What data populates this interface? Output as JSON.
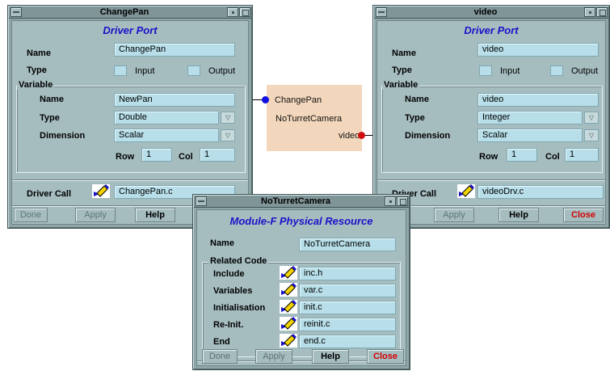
{
  "changepan_window": {
    "title": "ChangePan",
    "header": "Driver Port",
    "name_label": "Name",
    "name_value": "ChangePan",
    "type_label": "Type",
    "input_label": "Input",
    "output_label": "Output",
    "variable_label": "Variable",
    "var_name_label": "Name",
    "var_name_value": "NewPan",
    "var_type_label": "Type",
    "var_type_value": "Double",
    "dimension_label": "Dimension",
    "dimension_value": "Scalar",
    "row_label": "Row",
    "row_value": "1",
    "col_label": "Col",
    "col_value": "1",
    "driver_call_label": "Driver Call",
    "driver_call_value": "ChangePan.c",
    "buttons": {
      "done": "Done",
      "apply": "Apply",
      "help": "Help"
    }
  },
  "video_window": {
    "title": "video",
    "header": "Driver Port",
    "name_label": "Name",
    "name_value": "video",
    "type_label": "Type",
    "input_label": "Input",
    "output_label": "Output",
    "variable_label": "Variable",
    "var_name_label": "Name",
    "var_name_value": "video",
    "var_type_label": "Type",
    "var_type_value": "Integer",
    "dimension_label": "Dimension",
    "dimension_value": "Scalar",
    "row_label": "Row",
    "row_value": "1",
    "col_label": "Col",
    "col_value": "1",
    "driver_call_label": "Driver Call",
    "driver_call_value": "videoDrv.c",
    "buttons": {
      "apply": "Apply",
      "help": "Help",
      "close": "Close"
    }
  },
  "module_block": {
    "input_port": "ChangePan",
    "name": "NoTurretCamera",
    "output_port": "video",
    "input_port_color": "#1010e0",
    "output_port_color": "#d01010"
  },
  "noturret_window": {
    "title": "NoTurretCamera",
    "header": "Module-F Physical Resource",
    "name_label": "Name",
    "name_value": "NoTurretCamera",
    "related_code_label": "Related Code",
    "rows": [
      {
        "label": "Include",
        "value": "inc.h"
      },
      {
        "label": "Variables",
        "value": "var.c"
      },
      {
        "label": "Initialisation",
        "value": "init.c"
      },
      {
        "label": "Re-Init.",
        "value": "reinit.c"
      },
      {
        "label": "End",
        "value": "end.c"
      }
    ],
    "buttons": {
      "done": "Done",
      "apply": "Apply",
      "help": "Help",
      "close": "Close"
    }
  },
  "colors": {
    "header_text": "#1a12c8",
    "field_bg": "#b8dfe9",
    "window_bg": "#a6bdc0",
    "close_text": "#d40000",
    "module_bg": "#f2d7bc"
  },
  "icons": {
    "edit": "pencil-edit-icon",
    "dropdown": "dropdown-arrow-icon"
  }
}
